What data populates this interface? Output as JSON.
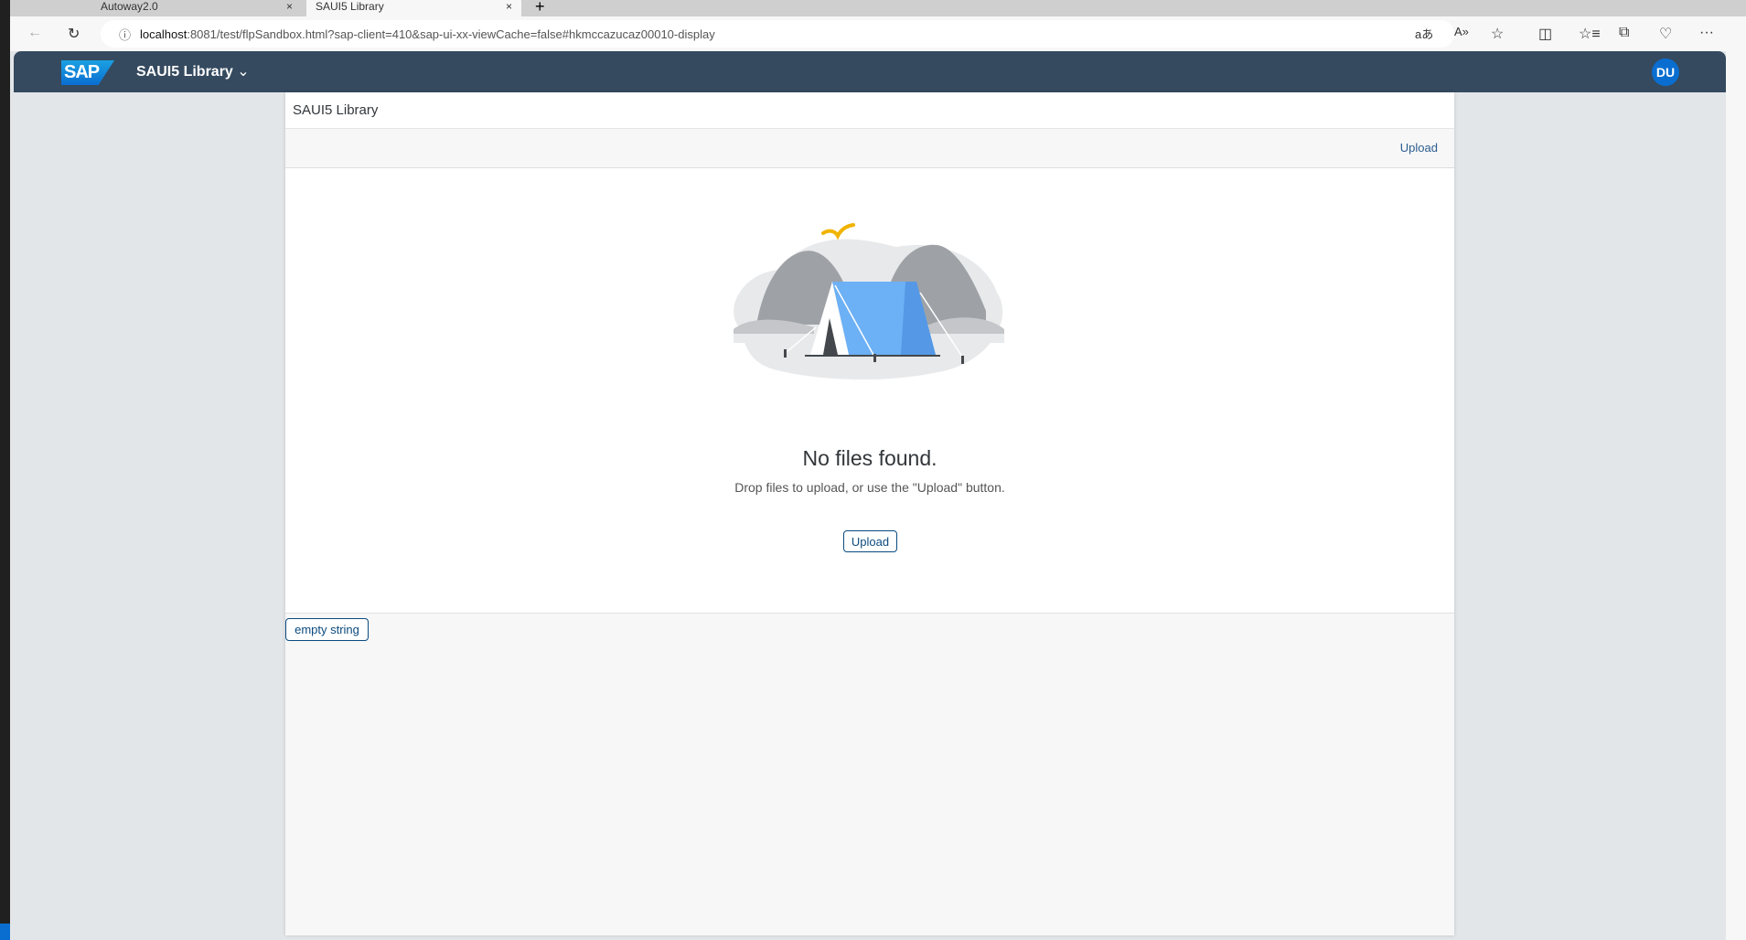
{
  "browser": {
    "tabs": [
      {
        "label": "Autoway2.0"
      },
      {
        "label": "SAUI5 Library"
      }
    ],
    "url_host": "localhost",
    "url_rest": ":8081/test/flpSandbox.html?sap-client=410&sap-ui-xx-viewCache=false#hkmccazucaz00010-display",
    "icons": {
      "tab_close": "×",
      "new_tab": "+",
      "back": "←",
      "reload": "↻",
      "info": "ⓘ",
      "translate": "aあ",
      "read_aloud": "A»",
      "favorite": "☆",
      "split": "◫",
      "favorites": "☆≡",
      "collections": "⧉",
      "health": "♡",
      "more": "···"
    }
  },
  "shell": {
    "logo": "SAP",
    "app_title": "SAUI5 Library",
    "avatar": "DU"
  },
  "page": {
    "title": "SAUI5 Library",
    "toolbar_upload": "Upload",
    "empty_title": "No files found.",
    "empty_description": "Drop files to upload, or use the \"Upload\" button.",
    "upload_button": "Upload",
    "empty_string_button": "empty string"
  },
  "colors": {
    "shell": "#354a5f",
    "accent": "#0a6ed1",
    "tent": "#6cb0f5"
  }
}
